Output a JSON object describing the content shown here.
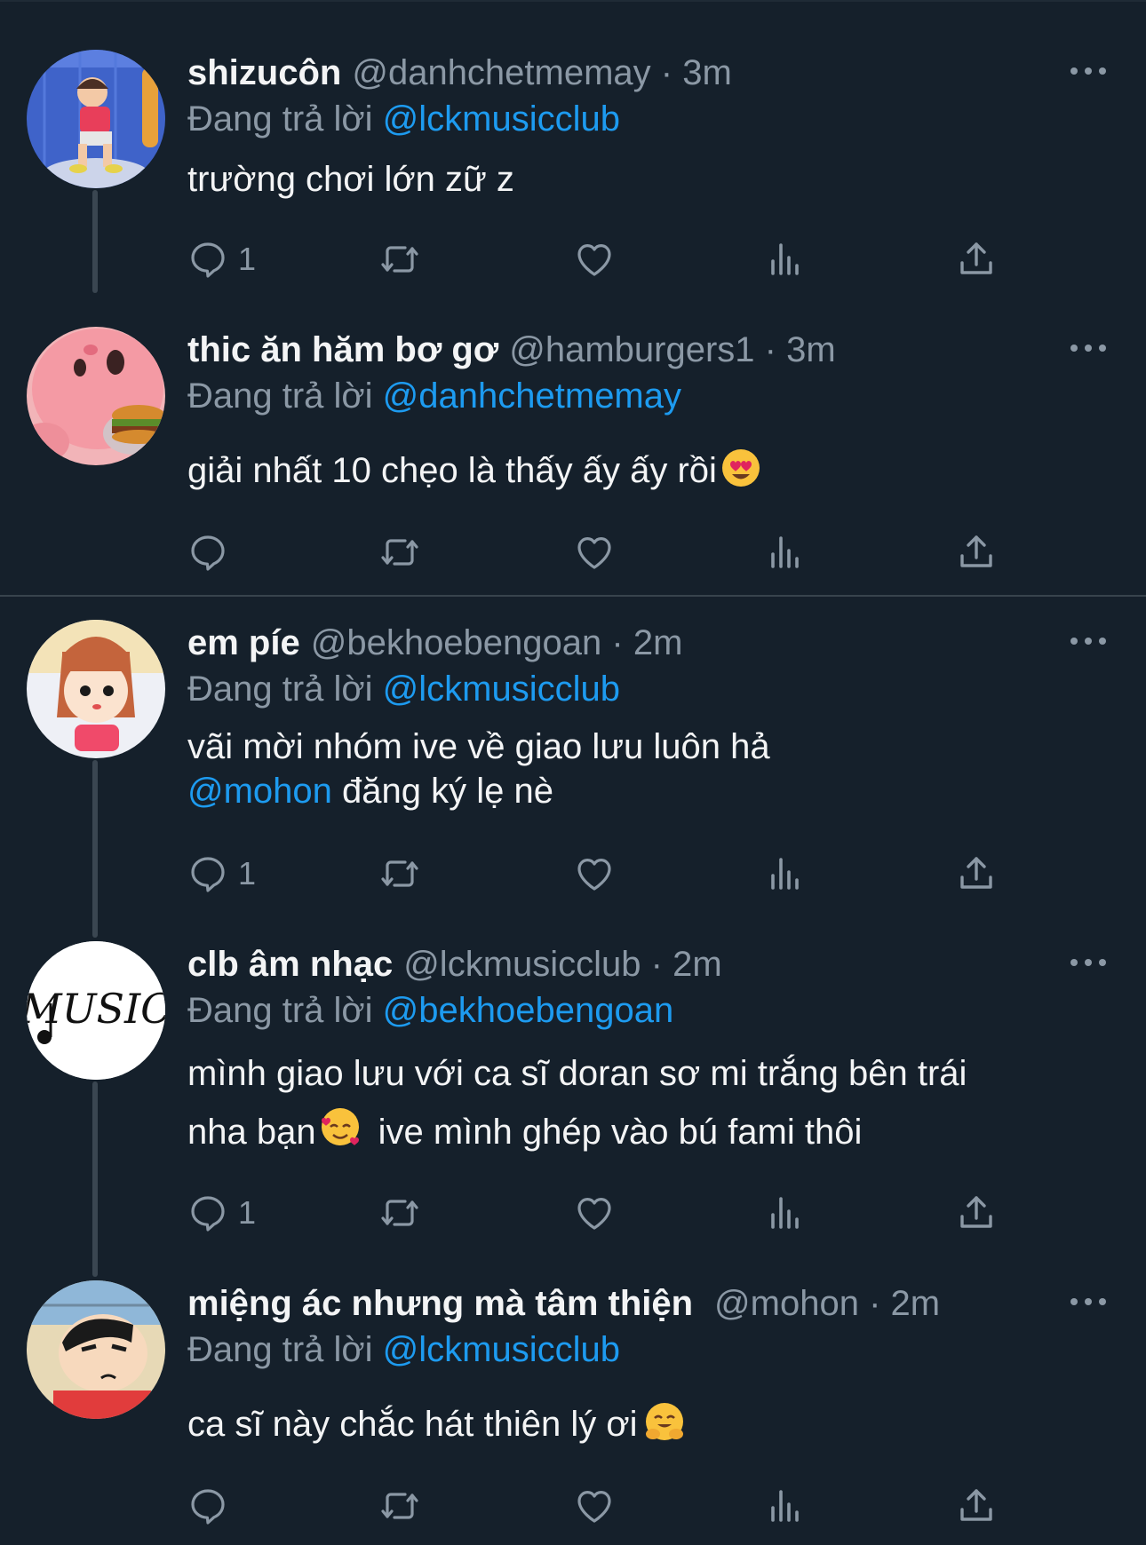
{
  "tweets": [
    {
      "name": "shizucôn",
      "handle": "@danhchetmemay",
      "time": "3m",
      "replying_label": "Đang trả lời",
      "replying_to": "@lckmusicclub",
      "text": "trường chơi lớn zữ z",
      "reply_count": "1"
    },
    {
      "name": "thic ăn hăm bơ gơ",
      "handle": "@hamburgers1",
      "time": "3m",
      "replying_label": "Đang trả lời",
      "replying_to": "@danhchetmemay",
      "text": "giải nhất 10 chẹo là thấy ấy ấy rồi",
      "emoji": "heart-eyes-emoji",
      "reply_count": ""
    },
    {
      "name": "em píe",
      "handle": "@bekhoebengoan",
      "time": "2m",
      "replying_label": "Đang trả lời",
      "replying_to": "@lckmusicclub",
      "text": "vãi mời nhóm ive về giao lưu luôn hả",
      "mention": "@mohon",
      "text2": "đăng ký lẹ nè",
      "reply_count": "1"
    },
    {
      "name": "clb âm nhạc",
      "handle": "@lckmusicclub",
      "time": "2m",
      "replying_label": "Đang trả lời",
      "replying_to": "@bekhoebengoan",
      "text": "mình giao lưu với ca sĩ doran sơ mi trắng bên trái",
      "text_line2a": "nha bạn",
      "emoji": "smiling-hearts-emoji",
      "text_line2b": "ive mình ghép vào bú fami thôi",
      "avatar_text": "MUSIC",
      "reply_count": "1"
    },
    {
      "name": "miệng ác nhưng mà tâm thiện",
      "handle": "@mohon",
      "time": "2m",
      "replying_label": "Đang trả lời",
      "replying_to": "@lckmusicclub",
      "text": "ca sĩ này chắc hát thiên lý ơi",
      "emoji": "hugging-emoji",
      "reply_count": ""
    }
  ],
  "separator": "·",
  "icons": [
    "reply-icon",
    "retweet-icon",
    "like-icon",
    "views-icon",
    "share-icon",
    "more-icon"
  ],
  "colors": {
    "background": "#15202b",
    "link": "#1d9bf0",
    "muted": "#8b98a5",
    "text": "#f3f4f5"
  }
}
